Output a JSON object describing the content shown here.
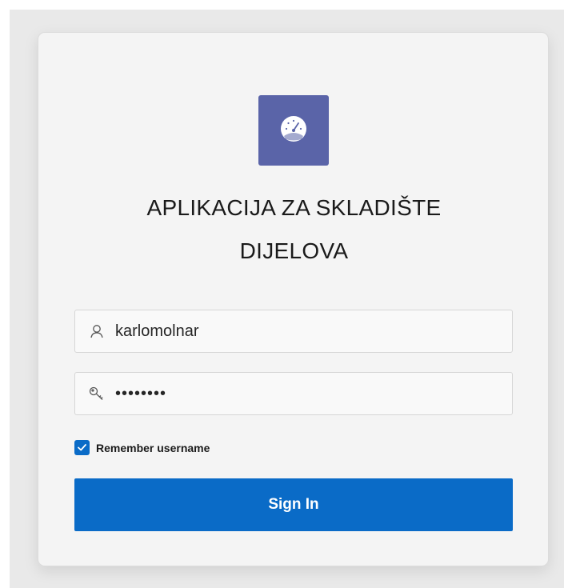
{
  "app": {
    "title_line1": "APLIKACIJA ZA SKLADIŠTE",
    "title_line2": "DIJELOVA",
    "logo_icon": "gauge-icon",
    "logo_color": "#5a64a8"
  },
  "form": {
    "username": {
      "icon": "user-icon",
      "value": "karlomolnar"
    },
    "password": {
      "icon": "key-icon",
      "value": "••••••••"
    },
    "remember": {
      "label": "Remember username",
      "checked": true
    },
    "submit_label": "Sign In"
  },
  "colors": {
    "accent": "#0a6bc7",
    "card_bg": "#f4f4f4",
    "page_bg": "#e9e9e9"
  }
}
